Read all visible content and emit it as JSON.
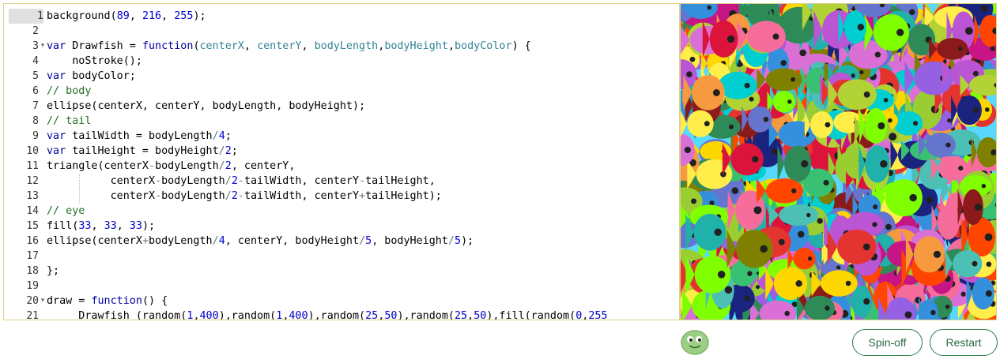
{
  "editor": {
    "active_line": 1,
    "lines": [
      {
        "n": "1",
        "fold": false,
        "t": [
          [
            "background(",
            ""
          ],
          [
            "89",
            "num"
          ],
          [
            ", ",
            ""
          ],
          [
            "216",
            "num"
          ],
          [
            ", ",
            ""
          ],
          [
            "255",
            "num"
          ],
          [
            ");",
            ""
          ]
        ]
      },
      {
        "n": "2",
        "fold": false,
        "t": []
      },
      {
        "n": "3",
        "fold": true,
        "t": [
          [
            "var",
            "kw"
          ],
          [
            " Drawfish = ",
            ""
          ],
          [
            "function",
            "kw"
          ],
          [
            "(",
            ""
          ],
          [
            "centerX",
            "param"
          ],
          [
            ", ",
            ""
          ],
          [
            "centerY",
            "param"
          ],
          [
            ", ",
            ""
          ],
          [
            "bodyLength",
            "param"
          ],
          [
            ",",
            ""
          ],
          [
            "bodyHeight",
            "param"
          ],
          [
            ",",
            ""
          ],
          [
            "bodyColor",
            "param"
          ],
          [
            ") {",
            ""
          ]
        ]
      },
      {
        "n": "4",
        "fold": false,
        "t": [
          [
            "    noStroke();",
            ""
          ]
        ]
      },
      {
        "n": "5",
        "fold": false,
        "t": [
          [
            "var",
            "kw"
          ],
          [
            " bodyColor;",
            ""
          ]
        ]
      },
      {
        "n": "6",
        "fold": false,
        "t": [
          [
            "// body",
            "com"
          ]
        ]
      },
      {
        "n": "7",
        "fold": false,
        "t": [
          [
            "ellipse(centerX, centerY, bodyLength, bodyHeight);",
            ""
          ]
        ]
      },
      {
        "n": "8",
        "fold": false,
        "t": [
          [
            "// tail",
            "com"
          ]
        ]
      },
      {
        "n": "9",
        "fold": false,
        "t": [
          [
            "var",
            "kw"
          ],
          [
            " tailWidth = bodyLength",
            ""
          ],
          [
            "/",
            "op"
          ],
          [
            "4",
            "num"
          ],
          [
            ";",
            ""
          ]
        ]
      },
      {
        "n": "10",
        "fold": false,
        "t": [
          [
            "var",
            "kw"
          ],
          [
            " tailHeight = bodyHeight",
            ""
          ],
          [
            "/",
            "op"
          ],
          [
            "2",
            "num"
          ],
          [
            ";",
            ""
          ]
        ]
      },
      {
        "n": "11",
        "fold": false,
        "t": [
          [
            "triangle(centerX",
            ""
          ],
          [
            "-",
            "op"
          ],
          [
            "bodyLength",
            ""
          ],
          [
            "/",
            "op"
          ],
          [
            "2",
            "num"
          ],
          [
            ", centerY,",
            ""
          ]
        ]
      },
      {
        "n": "12",
        "fold": false,
        "guide": true,
        "t": [
          [
            "          centerX",
            ""
          ],
          [
            "-",
            "op"
          ],
          [
            "bodyLength",
            ""
          ],
          [
            "/",
            "op"
          ],
          [
            "2",
            "num"
          ],
          [
            "-",
            "op"
          ],
          [
            "tailWidth, centerY",
            ""
          ],
          [
            "-",
            "op"
          ],
          [
            "tailHeight,",
            ""
          ]
        ]
      },
      {
        "n": "13",
        "fold": false,
        "guide": true,
        "t": [
          [
            "          centerX",
            ""
          ],
          [
            "-",
            "op"
          ],
          [
            "bodyLength",
            ""
          ],
          [
            "/",
            "op"
          ],
          [
            "2",
            "num"
          ],
          [
            "-",
            "op"
          ],
          [
            "tailWidth, centerY",
            ""
          ],
          [
            "+",
            "op"
          ],
          [
            "tailHeight);",
            ""
          ]
        ]
      },
      {
        "n": "14",
        "fold": false,
        "t": [
          [
            "// eye",
            "com"
          ]
        ]
      },
      {
        "n": "15",
        "fold": false,
        "t": [
          [
            "fill(",
            ""
          ],
          [
            "33",
            "num"
          ],
          [
            ", ",
            ""
          ],
          [
            "33",
            "num"
          ],
          [
            ", ",
            ""
          ],
          [
            "33",
            "num"
          ],
          [
            ");",
            ""
          ]
        ]
      },
      {
        "n": "16",
        "fold": false,
        "t": [
          [
            "ellipse(centerX",
            ""
          ],
          [
            "+",
            "op"
          ],
          [
            "bodyLength",
            ""
          ],
          [
            "/",
            "op"
          ],
          [
            "4",
            "num"
          ],
          [
            ", centerY, bodyHeight",
            ""
          ],
          [
            "/",
            "op"
          ],
          [
            "5",
            "num"
          ],
          [
            ", bodyHeight",
            ""
          ],
          [
            "/",
            "op"
          ],
          [
            "5",
            "num"
          ],
          [
            ");",
            ""
          ]
        ]
      },
      {
        "n": "17",
        "fold": false,
        "t": []
      },
      {
        "n": "18",
        "fold": false,
        "t": [
          [
            "};",
            ""
          ]
        ]
      },
      {
        "n": "19",
        "fold": false,
        "t": []
      },
      {
        "n": "20",
        "fold": true,
        "t": [
          [
            "draw = ",
            ""
          ],
          [
            "function",
            "kw"
          ],
          [
            "() {",
            ""
          ]
        ]
      },
      {
        "n": "21",
        "fold": false,
        "t": [
          [
            "     Drawfish (random(",
            ""
          ],
          [
            "1",
            "num"
          ],
          [
            ",",
            ""
          ],
          [
            "400",
            "num"
          ],
          [
            "),random(",
            ""
          ],
          [
            "1",
            "num"
          ],
          [
            ",",
            ""
          ],
          [
            "400",
            "num"
          ],
          [
            "),random(",
            ""
          ],
          [
            "25",
            "num"
          ],
          [
            ",",
            ""
          ],
          [
            "50",
            "num"
          ],
          [
            "),random(",
            ""
          ],
          [
            "25",
            "num"
          ],
          [
            ",",
            ""
          ],
          [
            "50",
            "num"
          ],
          [
            "),fill(random(",
            ""
          ],
          [
            "0",
            "num"
          ],
          [
            ",",
            ""
          ],
          [
            "255",
            "num"
          ]
        ]
      }
    ]
  },
  "canvas": {
    "background": "#59d8ff",
    "fish_colors": [
      "#e3342f",
      "#f6993f",
      "#ffed4a",
      "#38c172",
      "#4dc0b5",
      "#3490dc",
      "#6574cd",
      "#9561e2",
      "#f66d9b",
      "#b2d235",
      "#2e8b57",
      "#8b1a1a",
      "#1a237e",
      "#c71585",
      "#ffd700",
      "#7fff00",
      "#00ced1",
      "#ff4500",
      "#9acd32",
      "#da70d6",
      "#808000",
      "#20b2aa",
      "#dc143c",
      "#ba55d3"
    ]
  },
  "actions": {
    "spinoff_label": "Spin-off",
    "restart_label": "Restart"
  }
}
